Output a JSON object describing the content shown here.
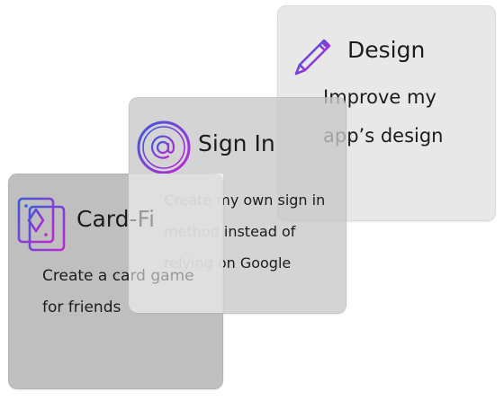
{
  "cards": [
    {
      "id": "design",
      "title": "Design",
      "description_lines": [
        "Improve my",
        "app’s design"
      ],
      "icon": "pencil-icon"
    },
    {
      "id": "signin",
      "title": "Sign In",
      "description_lines": [
        "Create my own sign in",
        "method instead of",
        "relying on Google"
      ],
      "icon": "at-sign-icon"
    },
    {
      "id": "cardfi",
      "title": "Card-Fi",
      "description_lines": [
        "Create a card game",
        "for friends"
      ],
      "icon": "playing-cards-icon"
    }
  ],
  "colors": {
    "icon_gradient_start": "#3b5bdb",
    "icon_gradient_end": "#c026d3",
    "design_card_bg": "#e8e8e8",
    "signin_card_bg": "#c8c8c8",
    "cardfi_card_bg": "#b4b4b4"
  }
}
